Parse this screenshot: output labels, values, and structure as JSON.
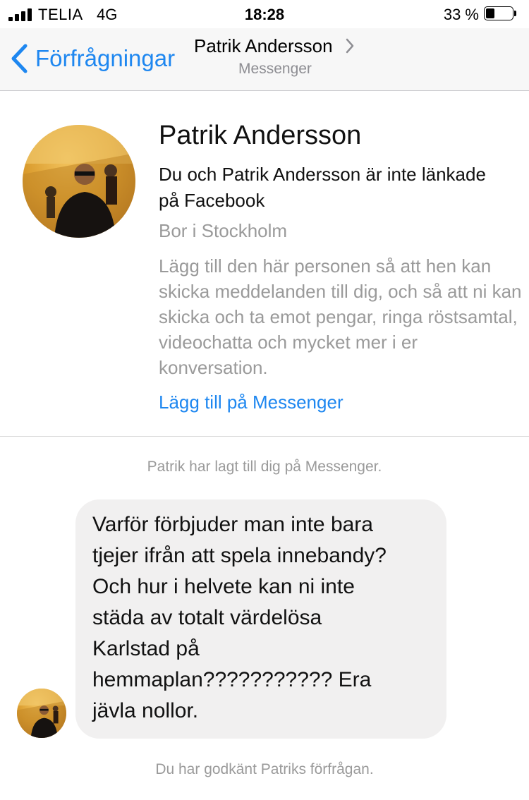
{
  "status_bar": {
    "carrier": "TELIA",
    "network": "4G",
    "time": "18:28",
    "battery_percent": "33 %",
    "battery_level": 0.33
  },
  "nav": {
    "back_label": "Förfrågningar",
    "title": "Patrik Andersson",
    "subtitle": "Messenger",
    "accent_color": "#1e87f0"
  },
  "profile": {
    "name": "Patrik Andersson",
    "not_linked": "Du och Patrik Andersson är inte länkade på Facebook",
    "lives_in": "Bor i Stockholm",
    "info": "Lägg till den här personen så att hen kan skicka meddelanden till dig, och så att ni kan skicka och ta emot pengar, ringa röstsamtal, videochatta och mycket mer i er konversation.",
    "add_button": "Lägg till på Messenger"
  },
  "thread": {
    "system_added": "Patrik har lagt till dig på Messenger.",
    "message_lines": [
      "Varför förbjuder man inte bara",
      "tjejer ifrån att spela innebandy?",
      "Och hur i helvete kan ni inte",
      "städa av totalt värdelösa",
      "Karlstad på",
      "hemmaplan??????????? Era",
      "jävla nollor."
    ],
    "system_accepted": "Du har godkänt Patriks förfrågan."
  }
}
